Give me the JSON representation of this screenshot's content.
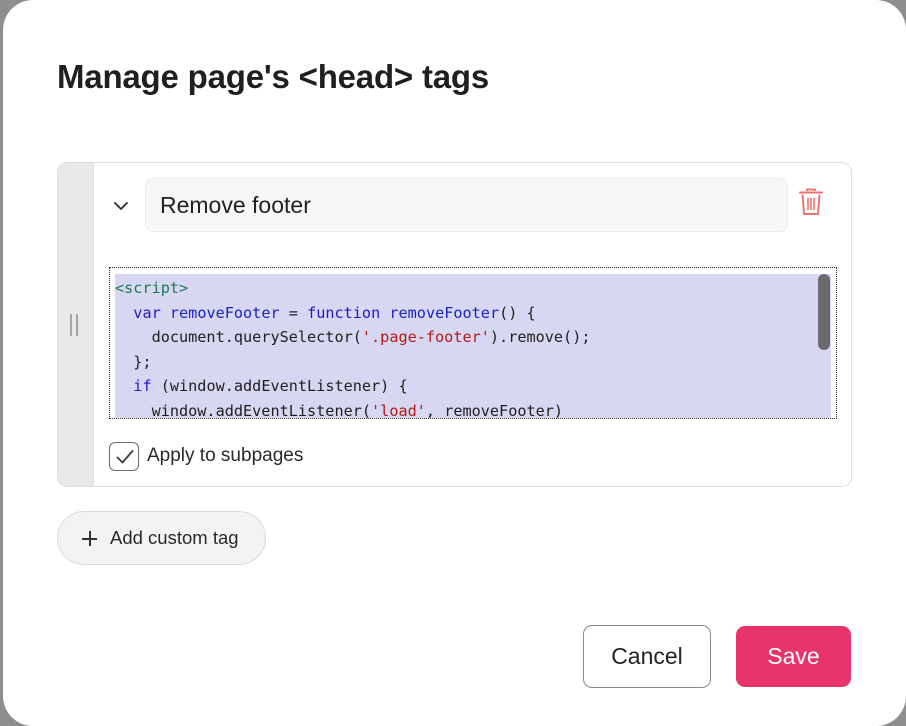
{
  "dialog": {
    "title": "Manage page's <head> tags"
  },
  "tag": {
    "name_value": "Remove footer",
    "code_lines": [
      [
        {
          "t": "tag",
          "v": "<script>"
        }
      ],
      [
        {
          "t": "plain",
          "v": "  "
        },
        {
          "t": "kw",
          "v": "var"
        },
        {
          "t": "plain",
          "v": " "
        },
        {
          "t": "fn",
          "v": "removeFooter"
        },
        {
          "t": "plain",
          "v": " = "
        },
        {
          "t": "kw",
          "v": "function"
        },
        {
          "t": "plain",
          "v": " "
        },
        {
          "t": "fn",
          "v": "removeFooter"
        },
        {
          "t": "plain",
          "v": "() {"
        }
      ],
      [
        {
          "t": "plain",
          "v": "    document.querySelector("
        },
        {
          "t": "str",
          "v": "'.page-footer'"
        },
        {
          "t": "plain",
          "v": ").remove();"
        }
      ],
      [
        {
          "t": "plain",
          "v": "  };"
        }
      ],
      [
        {
          "t": "plain",
          "v": "  "
        },
        {
          "t": "kw",
          "v": "if"
        },
        {
          "t": "plain",
          "v": " (window.addEventListener) {"
        }
      ],
      [
        {
          "t": "plain",
          "v": "    window.addEventListener("
        },
        {
          "t": "str",
          "v": "'load'"
        },
        {
          "t": "plain",
          "v": ", removeFooter)"
        }
      ]
    ],
    "apply_subpages_label": "Apply to subpages",
    "apply_subpages_checked": true
  },
  "actions": {
    "add_custom_tag_label": "Add custom tag",
    "cancel_label": "Cancel",
    "save_label": "Save"
  },
  "colors": {
    "accent": "#e8336b",
    "code_selection": "#d8d7f1"
  }
}
